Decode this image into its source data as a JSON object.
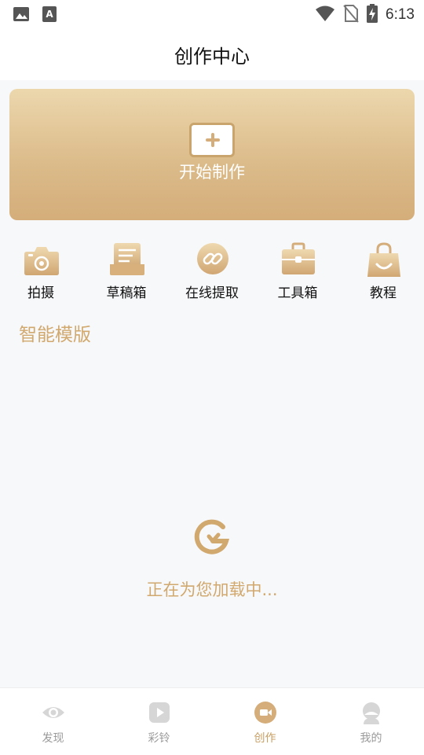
{
  "status_bar": {
    "time": "6:13",
    "icons": [
      "image-icon",
      "font-a-icon",
      "wifi-icon",
      "no-sim-icon",
      "battery-charging-icon"
    ]
  },
  "header": {
    "title": "创作中心"
  },
  "create_card": {
    "label": "开始制作",
    "icon": "plus-icon"
  },
  "quick_actions": [
    {
      "label": "拍摄",
      "icon": "camera-icon"
    },
    {
      "label": "草稿箱",
      "icon": "draft-box-icon"
    },
    {
      "label": "在线提取",
      "icon": "link-icon"
    },
    {
      "label": "工具箱",
      "icon": "toolbox-icon"
    },
    {
      "label": "教程",
      "icon": "shopping-bag-icon"
    }
  ],
  "section": {
    "title": "智能模版"
  },
  "loading": {
    "text": "正在为您加载中...",
    "icon": "loading-spinner-icon"
  },
  "tab_bar": {
    "tabs": [
      {
        "label": "发现",
        "icon": "eye-icon",
        "active": false
      },
      {
        "label": "彩铃",
        "icon": "play-icon",
        "active": false
      },
      {
        "label": "创作",
        "icon": "video-camera-icon",
        "active": true
      },
      {
        "label": "我的",
        "icon": "profile-icon",
        "active": false
      }
    ]
  },
  "colors": {
    "accent": "#d1a86d",
    "card_top": "#ecd7ad",
    "card_bottom": "#d4ad7a",
    "tab_inactive": "#9a9a9a",
    "background": "#f7f8fa"
  }
}
